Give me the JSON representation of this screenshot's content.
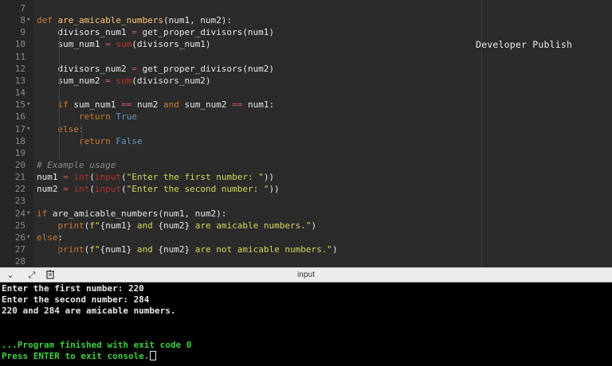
{
  "editor": {
    "watermark": "Developer Publish",
    "lines": [
      {
        "n": "7",
        "fold": "",
        "html": ""
      },
      {
        "n": "8",
        "fold": "▾",
        "html": "<span class=\"kw\">def</span> <span class=\"fn\">are_amicable_numbers</span>(num1, num2):"
      },
      {
        "n": "9",
        "fold": "",
        "html": "    divisors_num1 <span class=\"op\">=</span> get_proper_divisors(num1)"
      },
      {
        "n": "10",
        "fold": "",
        "html": "    sum_num1 <span class=\"op\">=</span> <span class=\"bi\">sum</span>(divisors_num1)"
      },
      {
        "n": "11",
        "fold": "",
        "html": ""
      },
      {
        "n": "12",
        "fold": "",
        "html": "    divisors_num2 <span class=\"op\">=</span> get_proper_divisors(num2)"
      },
      {
        "n": "13",
        "fold": "",
        "html": "    sum_num2 <span class=\"op\">=</span> <span class=\"bi\">sum</span>(divisors_num2)"
      },
      {
        "n": "14",
        "fold": "",
        "html": ""
      },
      {
        "n": "15",
        "fold": "▾",
        "html": "    <span class=\"kw\">if</span> sum_num1 <span class=\"op\">==</span> num2 <span class=\"kw\">and</span> sum_num2 <span class=\"op\">==</span> num1:"
      },
      {
        "n": "16",
        "fold": "",
        "html": "        <span class=\"kw\">return</span> <span class=\"bool\">True</span>"
      },
      {
        "n": "17",
        "fold": "▾",
        "html": "    <span class=\"kw\">else</span>:"
      },
      {
        "n": "18",
        "fold": "",
        "html": "        <span class=\"kw\">return</span> <span class=\"bool\">False</span>"
      },
      {
        "n": "19",
        "fold": "",
        "html": ""
      },
      {
        "n": "20",
        "fold": "",
        "html": "<span class=\"cm\"># Example usage</span>"
      },
      {
        "n": "21",
        "fold": "",
        "html": "num1 <span class=\"op\">=</span> <span class=\"bi\">int</span>(<span class=\"bi\">input</span>(<span class=\"str\">\"Enter the first number: \"</span>))"
      },
      {
        "n": "22",
        "fold": "",
        "html": "num2 <span class=\"op\">=</span> <span class=\"bi\">int</span>(<span class=\"bi\">input</span>(<span class=\"str\">\"Enter the second number: \"</span>))"
      },
      {
        "n": "23",
        "fold": "",
        "html": ""
      },
      {
        "n": "24",
        "fold": "▾",
        "html": "<span class=\"kw\">if</span> are_amicable_numbers(num1, num2):"
      },
      {
        "n": "25",
        "fold": "",
        "html": "    <span class=\"kw\">print</span>(<span class=\"str\">f\"</span>{num1}<span class=\"str\"> and </span>{num2}<span class=\"str\"> are amicable numbers.\"</span>)"
      },
      {
        "n": "26",
        "fold": "▾",
        "html": "<span class=\"kw\">else</span>:"
      },
      {
        "n": "27",
        "fold": "",
        "html": "    <span class=\"kw\">print</span>(<span class=\"str\">f\"</span>{num1}<span class=\"str\"> and </span>{num2}<span class=\"str\"> are not amicable numbers.\"</span>)"
      },
      {
        "n": "28",
        "fold": "",
        "html": ""
      }
    ]
  },
  "io_panel": {
    "title": "input",
    "icons": [
      "chevron-down-icon",
      "expand-icon",
      "clear-console-icon"
    ]
  },
  "console": {
    "lines": [
      {
        "text": "Enter the first number: 220",
        "color": "white"
      },
      {
        "text": "Enter the second number: 284",
        "color": "white"
      },
      {
        "text": "220 and 284 are amicable numbers.",
        "color": "white"
      },
      {
        "text": "",
        "color": "white"
      },
      {
        "text": "",
        "color": "white"
      },
      {
        "text": "...Program finished with exit code 0",
        "color": "green"
      },
      {
        "text": "Press ENTER to exit console.",
        "color": "green",
        "cursor": true
      }
    ]
  }
}
